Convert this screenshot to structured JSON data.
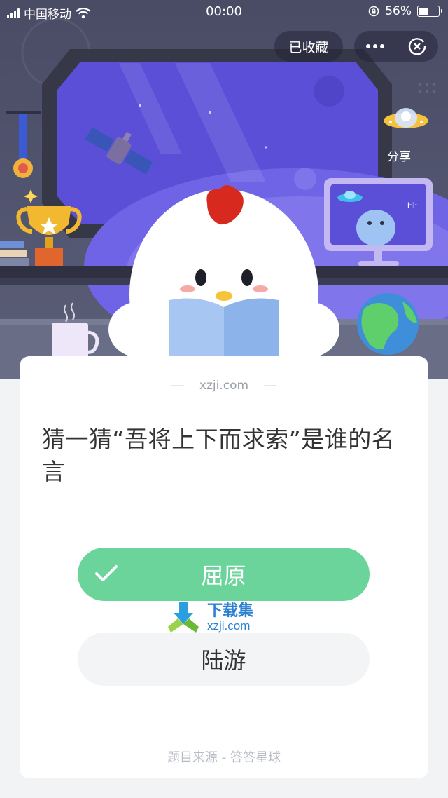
{
  "status_bar": {
    "carrier": "中国移动",
    "time": "00:00",
    "battery_percent": "56%",
    "battery_level": 0.56
  },
  "header": {
    "favorited_label": "已收藏",
    "share_label": "分享"
  },
  "scene": {
    "monitor_text": "Hi~"
  },
  "card": {
    "watermark": "xzji.com",
    "question": "猜一猜“吾将上下而求索”是谁的名言",
    "options": [
      {
        "label": "屈原",
        "selected": true,
        "correct": true
      },
      {
        "label": "陆游",
        "selected": false
      }
    ],
    "logo_watermark": {
      "title": "下载集",
      "domain": "xzji.com"
    },
    "source": "题目来源 - 答答星球"
  },
  "colors": {
    "correct_green": "#6bd49b",
    "scene_bg": "#4e5069",
    "window_purple": "#5b4fd8"
  }
}
